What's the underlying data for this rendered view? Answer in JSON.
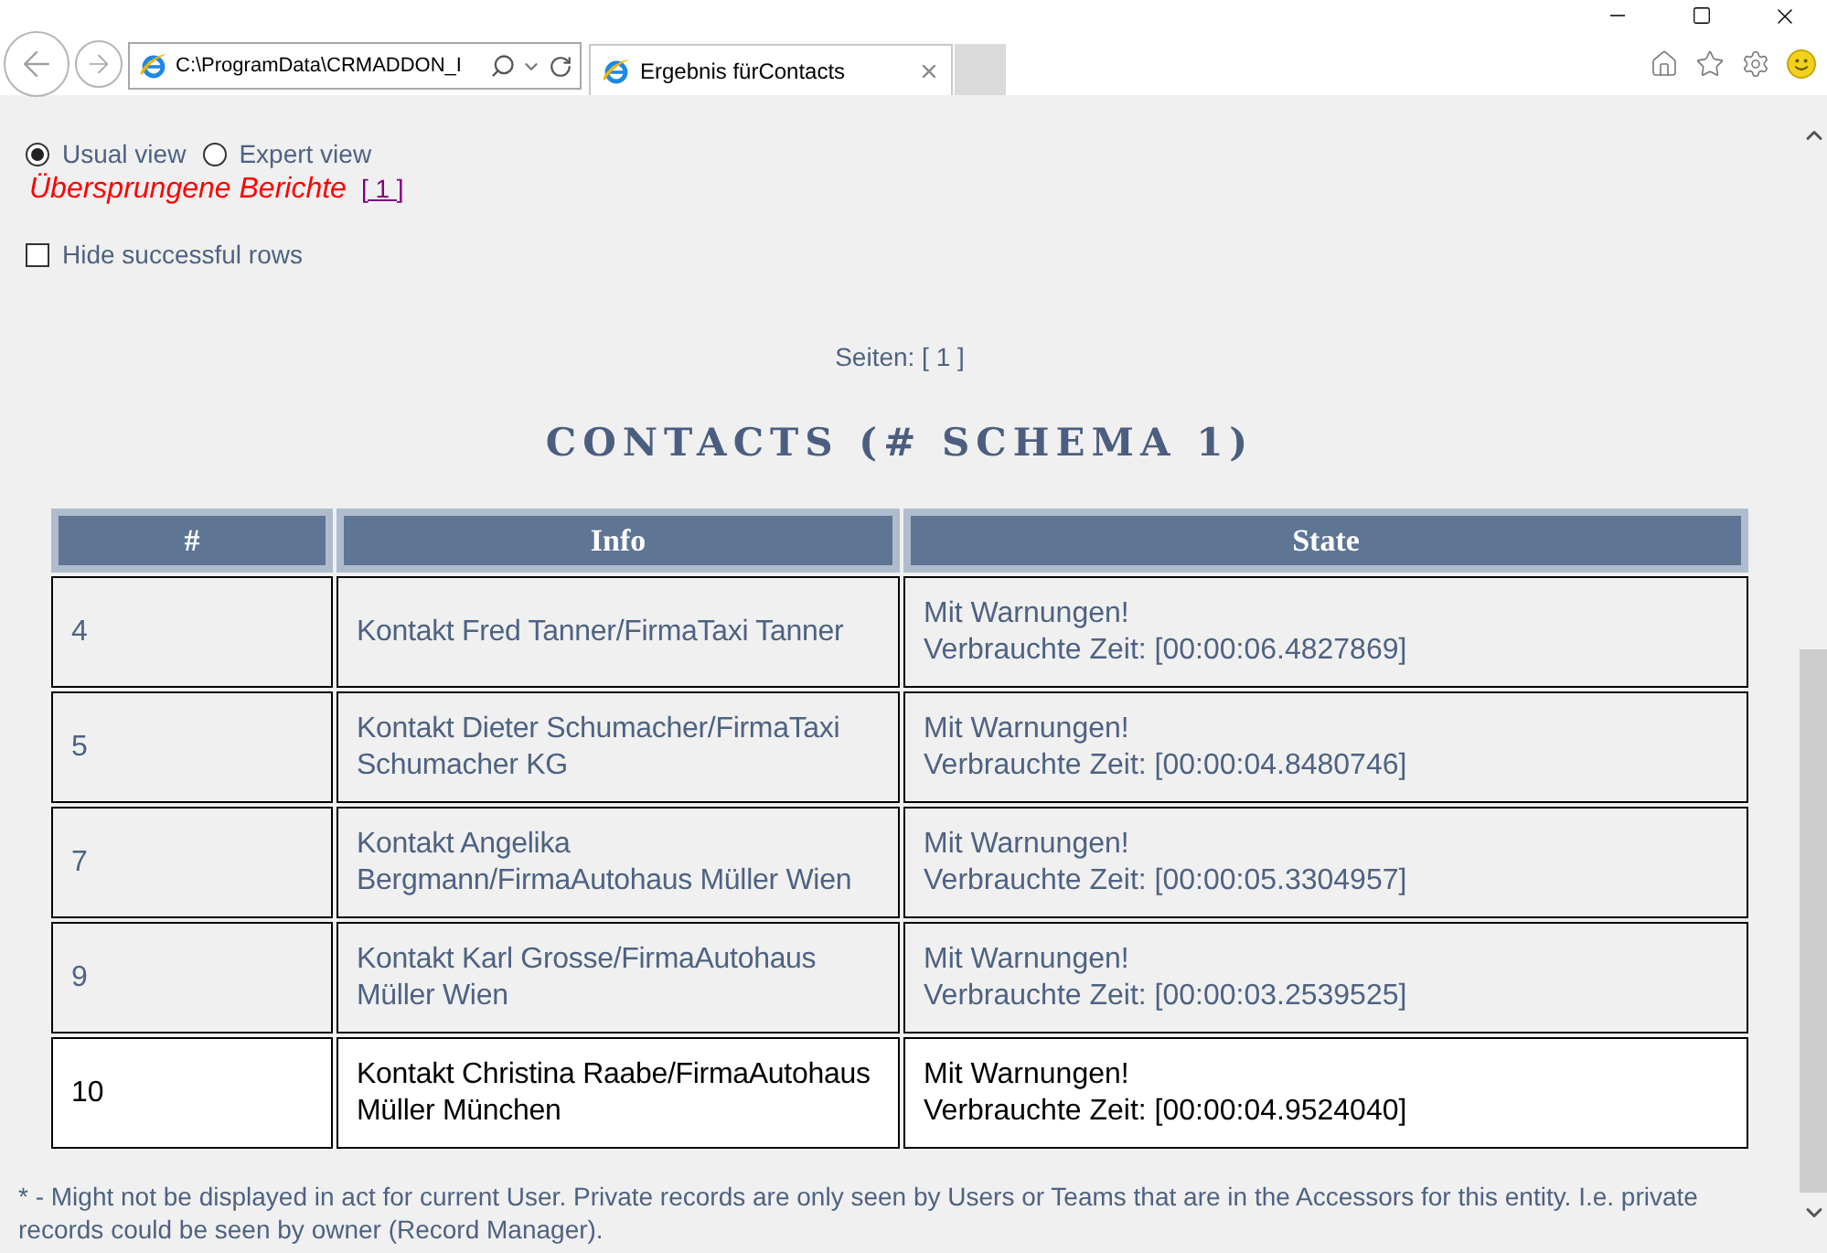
{
  "browser": {
    "address": "C:\\ProgramData\\CRMADDON_I",
    "tab_title": "Ergebnis fürContacts"
  },
  "view_options": [
    {
      "label": "Usual view",
      "selected": true
    },
    {
      "label": "Expert view",
      "selected": false
    }
  ],
  "skipped_reports": {
    "label": "Übersprungene Berichte",
    "link": "[ 1 ]"
  },
  "hide_successful_rows": {
    "label": "Hide successful rows",
    "checked": false
  },
  "pages": "Seiten: [ 1 ]",
  "title": "CONTACTS (# SCHEMA 1)",
  "table": {
    "columns": [
      "#",
      "Info",
      "State"
    ],
    "rows": [
      {
        "number": "4",
        "info": "Kontakt Fred Tanner/FirmaTaxi Tanner",
        "status": "Mit Warnungen!",
        "time": "Verbrauchte Zeit: [00:00:06.4827869]",
        "selected": false
      },
      {
        "number": "5",
        "info": "Kontakt Dieter Schumacher/FirmaTaxi Schumacher KG",
        "status": "Mit Warnungen!",
        "time": "Verbrauchte Zeit: [00:00:04.8480746]",
        "selected": false
      },
      {
        "number": "7",
        "info": "Kontakt Angelika Bergmann/FirmaAutohaus Müller Wien",
        "status": "Mit Warnungen!",
        "time": "Verbrauchte Zeit: [00:00:05.3304957]",
        "selected": false
      },
      {
        "number": "9",
        "info": "Kontakt Karl Grosse/FirmaAutohaus Müller Wien",
        "status": "Mit Warnungen!",
        "time": "Verbrauchte Zeit: [00:00:03.2539525]",
        "selected": false
      },
      {
        "number": "10",
        "info": "Kontakt Christina Raabe/FirmaAutohaus Müller München",
        "status": "Mit Warnungen!",
        "time": "Verbrauchte Zeit: [00:00:04.9524040]",
        "selected": true
      }
    ]
  },
  "footnote": "* - Might not be displayed in act for current User. Private records are only seen by Users or Teams that are in the Accessors for this entity. I.e. private records could be seen by owner (Record Manager)."
}
